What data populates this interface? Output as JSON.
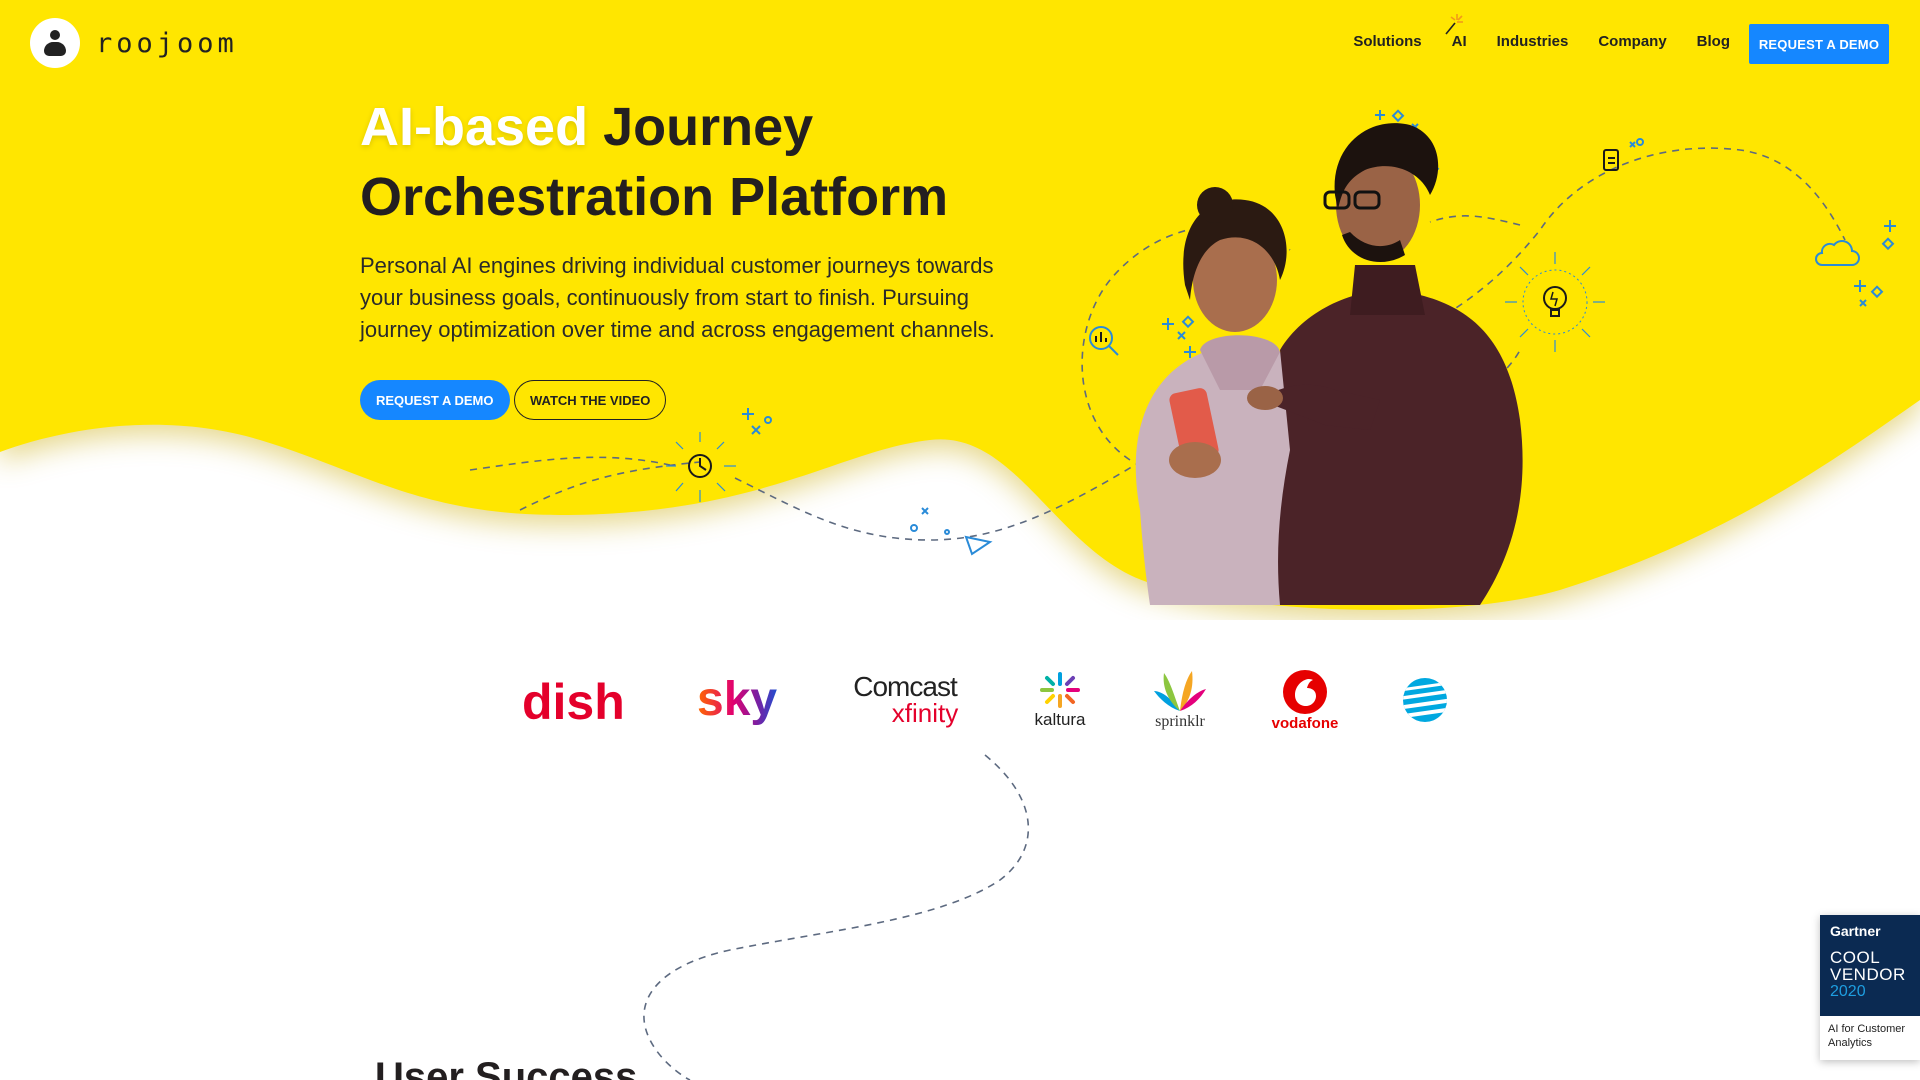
{
  "brand": {
    "name": "roojoom"
  },
  "nav": {
    "items": [
      "Solutions",
      "AI",
      "Industries",
      "Company",
      "Blog"
    ],
    "cta": "REQUEST A DEMO"
  },
  "hero": {
    "title_highlight": "AI-based",
    "title_rest_line1": " Journey",
    "title_line2": "Orchestration Platform",
    "subtitle": "Personal AI engines driving individual customer journeys towards your business goals, continuously from start to finish. Pursuing journey optimization over time and across engagement channels.",
    "primary_cta": "REQUEST A DEMO",
    "secondary_cta": "WATCH THE VIDEO"
  },
  "clients": {
    "logos": [
      "dish",
      "sky",
      "Comcast xfinity",
      "kaltura",
      "sprinklr",
      "vodafone",
      "AT&T"
    ],
    "comcast_top": "Comcast",
    "comcast_bottom": "xfinity",
    "kaltura": "kaltura",
    "sprinklr": "sprinklr",
    "vodafone": "vodafone"
  },
  "gartner_badge": {
    "brand": "Gartner",
    "line1": "COOL",
    "line2": "VENDOR",
    "year": "2020",
    "caption": "AI for Customer Analytics"
  },
  "next_section": {
    "heading": "User Success"
  },
  "colors": {
    "hero_yellow": "#ffe600",
    "accent_blue": "#1587ff",
    "text_dark": "#231f20",
    "gartner_navy": "#0b2a52"
  }
}
